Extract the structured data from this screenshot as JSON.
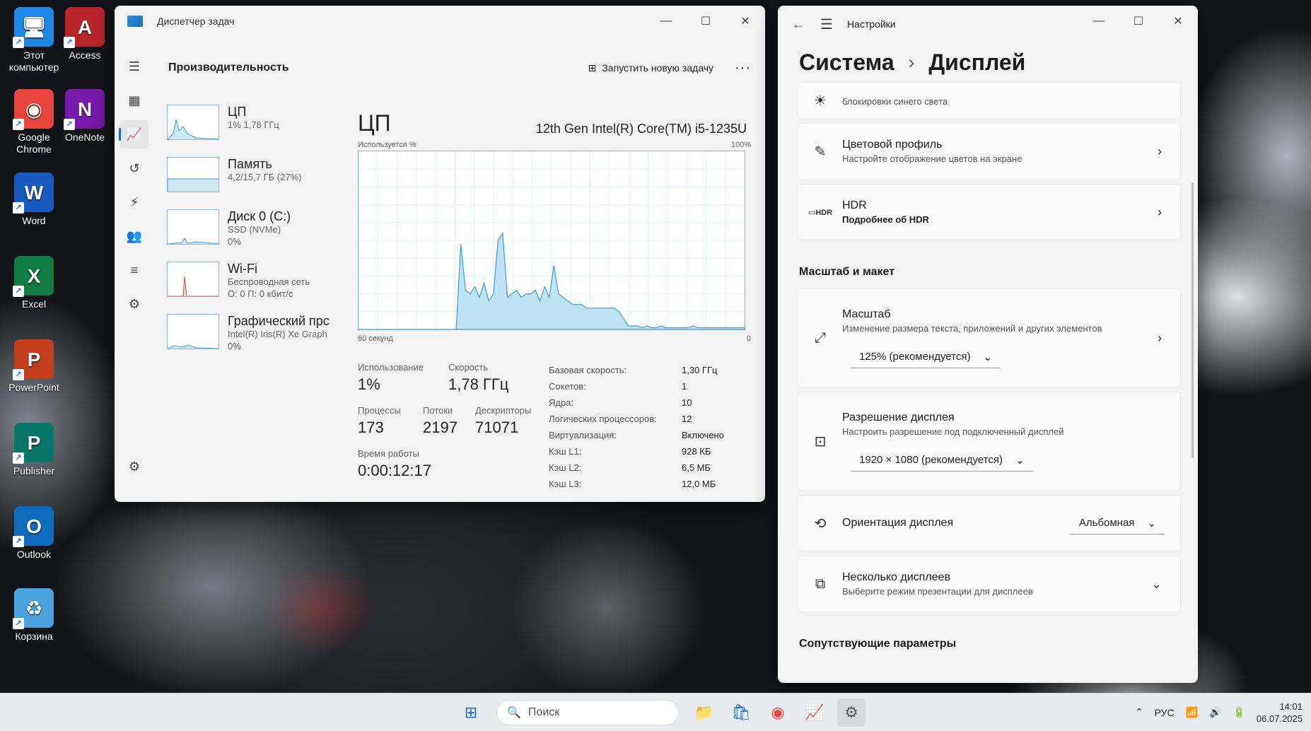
{
  "desktop": {
    "icons": [
      {
        "label": "Этот компьютер",
        "glyph": "🖥",
        "color": "#1e88e5"
      },
      {
        "label": "Access",
        "glyph": "A",
        "color": "#b7262b"
      },
      {
        "label": "Google Chrome",
        "glyph": "◉",
        "color": "#e8453c"
      },
      {
        "label": "OneNote",
        "glyph": "N",
        "color": "#7719aa"
      },
      {
        "label": "Word",
        "glyph": "W",
        "color": "#185abd"
      },
      {
        "label": "Excel",
        "glyph": "X",
        "color": "#107c41"
      },
      {
        "label": "PowerPoint",
        "glyph": "P",
        "color": "#c43e1c"
      },
      {
        "label": "Publisher",
        "glyph": "P",
        "color": "#077568"
      },
      {
        "label": "Outlook",
        "glyph": "O",
        "color": "#0f6cbd"
      },
      {
        "label": "Корзина",
        "glyph": "♻",
        "color": "#4aa3df"
      }
    ]
  },
  "taskmanager": {
    "title": "Диспетчер задач",
    "section_title": "Производительность",
    "new_task_label": "Запустить новую задачу",
    "more_label": "···",
    "perf_items": [
      {
        "name": "ЦП",
        "sub1": "1% 1,78 ГГц",
        "sub2": ""
      },
      {
        "name": "Память",
        "sub1": "4,2/15,7 ГБ (27%)",
        "sub2": ""
      },
      {
        "name": "Диск 0 (C:)",
        "sub1": "SSD (NVMe)",
        "sub2": "0%"
      },
      {
        "name": "Wi-Fi",
        "sub1": "Беспроводная сеть",
        "sub2": "О: 0 П: 0 кбит/с"
      },
      {
        "name": "Графический прс",
        "sub1": "Intel(R) Iris(R) Xe Graph",
        "sub2": "0%"
      }
    ],
    "cpu": {
      "title": "ЦП",
      "model": "12th Gen Intel(R) Core(TM) i5-1235U",
      "graph_ylabel": "Используется %",
      "graph_ymax": "100%",
      "graph_xlabel": "60 секунд",
      "graph_xmin": "0",
      "usage_label": "Использование",
      "usage_value": "1%",
      "speed_label": "Скорость",
      "speed_value": "1,78 ГГц",
      "processes_label": "Процессы",
      "processes_value": "173",
      "threads_label": "Потоки",
      "threads_value": "2197",
      "handles_label": "Дескрипторы",
      "handles_value": "71071",
      "uptime_label": "Время работы",
      "uptime_value": "0:00:12:17",
      "details": [
        {
          "k": "Базовая скорость:",
          "v": "1,30 ГГц"
        },
        {
          "k": "Сокетов:",
          "v": "1"
        },
        {
          "k": "Ядра:",
          "v": "10"
        },
        {
          "k": "Логических процессоров:",
          "v": "12"
        },
        {
          "k": "Виртуализация:",
          "v": "Включено"
        },
        {
          "k": "Кэш L1:",
          "v": "928 КБ"
        },
        {
          "k": "Кэш L2:",
          "v": "6,5 МБ"
        },
        {
          "k": "Кэш L3:",
          "v": "12,0 МБ"
        }
      ]
    }
  },
  "settings": {
    "app_title": "Настройки",
    "breadcrumb_parent": "Система",
    "breadcrumb_sep": "›",
    "breadcrumb_current": "Дисплей",
    "partial_card_desc": "блокировки синего света",
    "color_profile_title": "Цветовой профиль",
    "color_profile_desc": "Настройте отображение цветов на экране",
    "hdr_title": "HDR",
    "hdr_link": "Подробнее об HDR",
    "scale_section": "Масштаб и макет",
    "scale_title": "Масштаб",
    "scale_desc": "Изменение размера текста, приложений и других элементов",
    "scale_value": "125% (рекомендуется)",
    "resolution_title": "Разрешение дисплея",
    "resolution_desc": "Настроить разрешение под подключенный дисплей",
    "resolution_value": "1920 × 1080 (рекомендуется)",
    "orientation_title": "Ориентация дисплея",
    "orientation_value": "Альбомная",
    "multi_title": "Несколько дисплеев",
    "multi_desc": "Выберите режим презентации для дисплеев",
    "related_section": "Сопутствующие параметры"
  },
  "taskbar": {
    "search_placeholder": "Поиск",
    "language": "РУС",
    "time": "14:01",
    "date": "06.07.2025"
  },
  "colors": {
    "accent": "#1e6bbd",
    "graph_fill": "#bfe3f2",
    "graph_line": "#3a9fd1"
  },
  "graph_series": [
    0,
    0,
    0,
    0,
    0,
    0,
    0,
    0,
    0,
    0,
    0,
    0,
    0,
    0,
    0,
    0,
    0,
    0,
    0,
    0,
    0,
    0,
    48,
    22,
    20,
    24,
    18,
    26,
    16,
    20,
    50,
    54,
    18,
    20,
    22,
    18,
    20,
    20,
    22,
    16,
    24,
    18,
    36,
    20,
    18,
    16,
    14,
    14,
    14,
    12,
    12,
    12,
    12,
    12,
    12,
    12,
    10,
    6,
    2,
    2,
    2,
    1,
    2,
    1,
    1,
    2,
    1,
    1,
    1,
    1,
    1,
    1,
    2,
    1,
    1,
    1,
    1,
    1,
    1,
    1,
    1,
    1,
    1,
    1
  ]
}
